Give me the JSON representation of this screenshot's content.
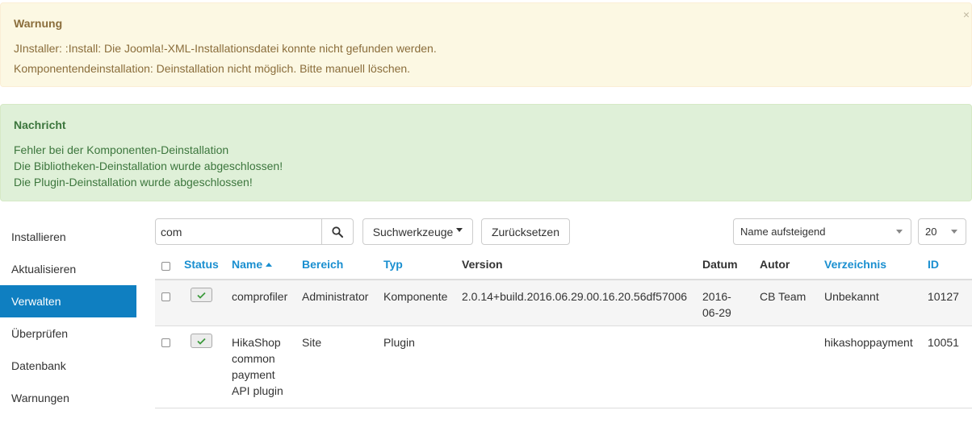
{
  "warning": {
    "title": "Warnung",
    "messages": [
      "JInstaller: :Install: Die Joomla!-XML-Installationsdatei konnte nicht gefunden werden.",
      "Komponentendeinstallation: Deinstallation nicht möglich. Bitte manuell löschen."
    ]
  },
  "message": {
    "title": "Nachricht",
    "messages": [
      "Fehler bei der Komponenten-Deinstallation",
      "Die Bibliotheken-Deinstallation wurde abgeschlossen!",
      "Die Plugin-Deinstallation wurde abgeschlossen!"
    ]
  },
  "sidebar": {
    "items": [
      {
        "label": "Installieren"
      },
      {
        "label": "Aktualisieren"
      },
      {
        "label": "Verwalten"
      },
      {
        "label": "Überprüfen"
      },
      {
        "label": "Datenbank"
      },
      {
        "label": "Warnungen"
      }
    ]
  },
  "toolbar": {
    "search_value": "com",
    "search_tools_label": "Suchwerkzeuge",
    "reset_label": "Zurücksetzen",
    "sort_selected": "Name aufsteigend",
    "limit_selected": "20"
  },
  "table": {
    "columns": [
      "Status",
      "Name",
      "Bereich",
      "Typ",
      "Version",
      "Datum",
      "Autor",
      "Verzeichnis",
      "ID"
    ],
    "rows": [
      {
        "name": "comprofiler",
        "bereich": "Administrator",
        "typ": "Komponente",
        "version": "2.0.14+build.2016.06.29.00.16.20.56df57006",
        "datum_1": "2016-",
        "datum_2": "06-29",
        "autor": "CB Team",
        "verzeichnis": "Unbekannt",
        "id": "10127"
      },
      {
        "name_lines": [
          "HikaShop",
          "common",
          "payment",
          "API plugin"
        ],
        "bereich": "Site",
        "typ": "Plugin",
        "version": "",
        "datum_1": "",
        "datum_2": "",
        "autor": "",
        "verzeichnis": "hikashoppayment",
        "id": "10051"
      }
    ]
  },
  "colors": {
    "accent": "#0f7fc1",
    "link": "#1a8fd0",
    "warning_bg": "#fcf8e3",
    "success_bg": "#dff0d8"
  }
}
